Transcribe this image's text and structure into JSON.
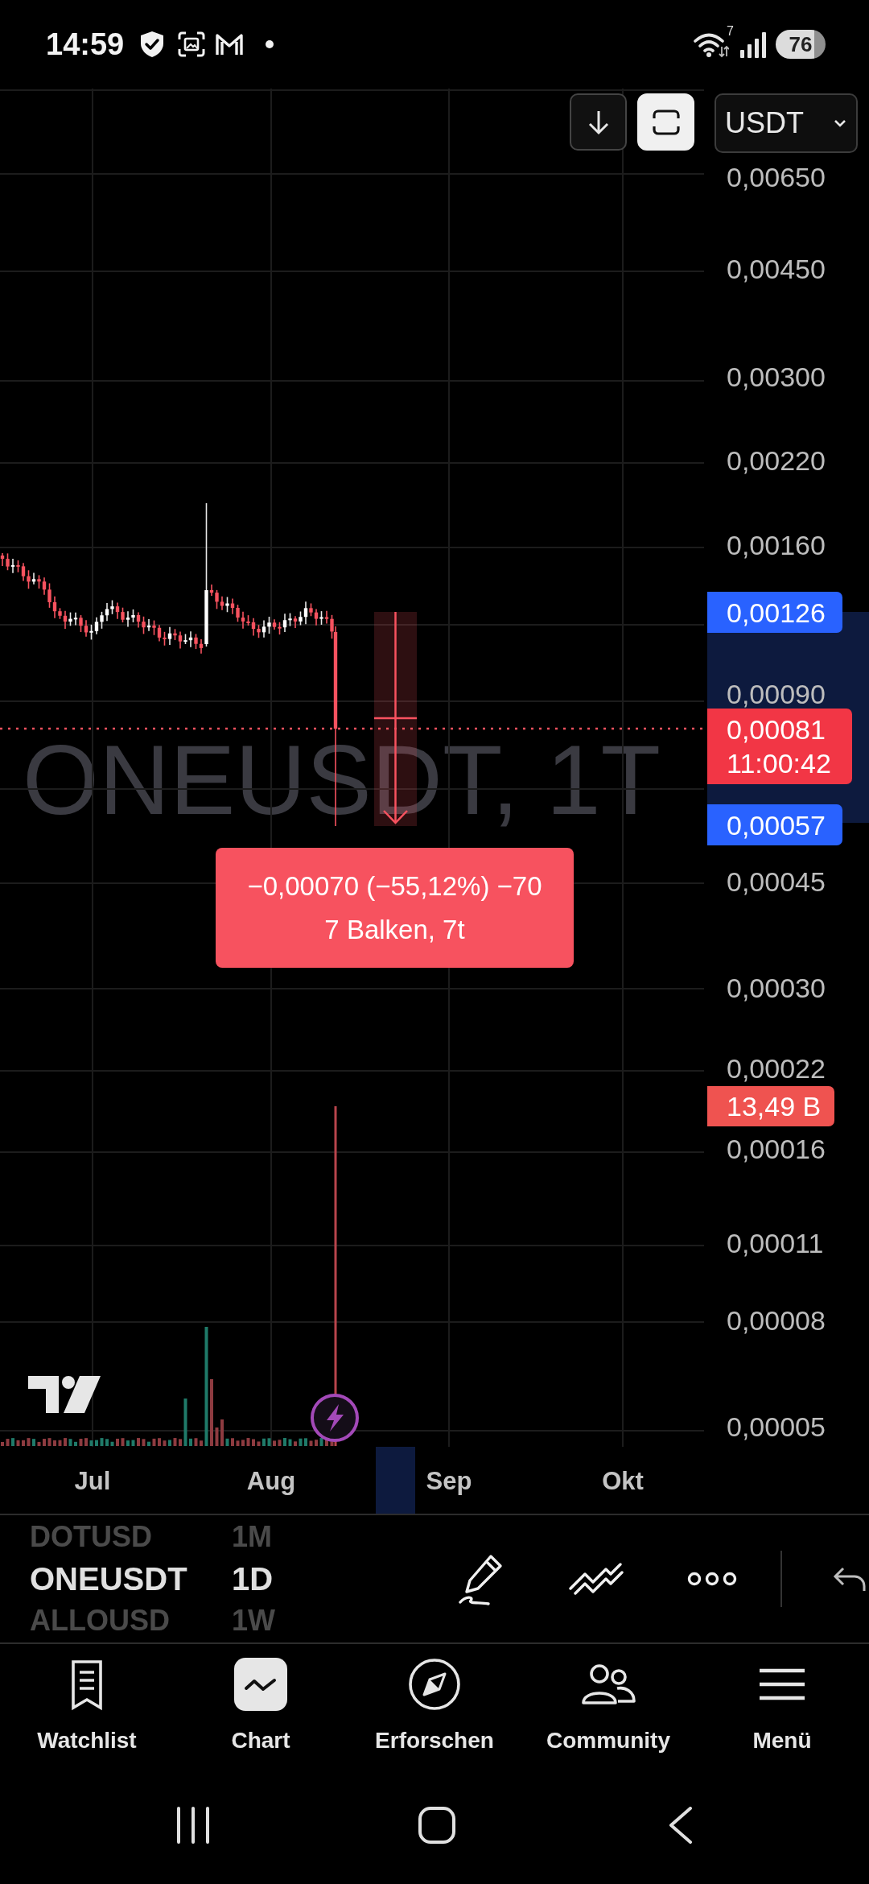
{
  "status_bar": {
    "time": "14:59",
    "wifi_label": "7",
    "battery": "76"
  },
  "chart_controls": {
    "buttons": [
      {
        "kind": "scroll",
        "selected": false
      },
      {
        "kind": "frame",
        "selected": true
      }
    ],
    "currency": "USDT"
  },
  "chart": {
    "watermark": "ONEUSDT, 1T",
    "price_labels": [
      "0,00650",
      "0,00450",
      "0,00300",
      "0,00220",
      "0,00160",
      "0,00090",
      "0,00045",
      "0,00030",
      "0,00022",
      "0,00016",
      "0,00011",
      "0,00008",
      "0,00005"
    ],
    "price_tags": [
      {
        "kind": "range",
        "text": "0,00126",
        "color": "#2962ff"
      },
      {
        "kind": "last",
        "text": "0,00081",
        "countdown": "11:00:42",
        "color": "#f23645"
      },
      {
        "kind": "range",
        "text": "0,00057",
        "color": "#2962ff"
      },
      {
        "kind": "volume",
        "text": "13,49 B",
        "color": "#ef5350"
      }
    ],
    "measurement": {
      "change": "−0,00070 (−55,12%) −70",
      "span": "7 Balken, 7t"
    },
    "time_labels": [
      "Jul",
      "Aug",
      "Sep",
      "Okt"
    ]
  },
  "symbol_picker": [
    {
      "symbol": "DOTUSD",
      "interval": "1M",
      "selected": false
    },
    {
      "symbol": "ONEUSDT",
      "interval": "1D",
      "selected": true
    },
    {
      "symbol": "ALLOUSD",
      "interval": "1W",
      "selected": false
    }
  ],
  "bottom_nav": [
    {
      "label": "Watchlist",
      "selected": false
    },
    {
      "label": "Chart",
      "selected": true
    },
    {
      "label": "Erforschen",
      "selected": false
    },
    {
      "label": "Community",
      "selected": false
    },
    {
      "label": "Menü",
      "selected": false
    }
  ]
}
